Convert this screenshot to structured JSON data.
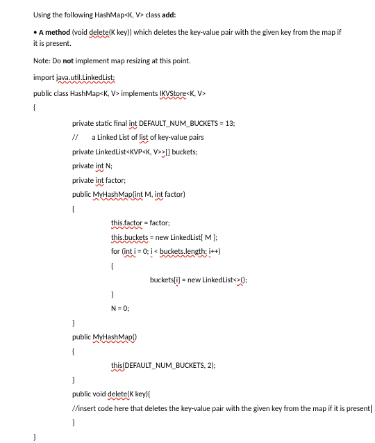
{
  "intro_prefix": "Using the following HashMap<K, V> class ",
  "intro_bold": "add:",
  "bullet_bold": "A method",
  "bullet_prefix": " (void ",
  "bullet_wavy": "delete(",
  "bullet_after": "K key)) which deletes the key-value pair with the given key from the map if it is present.",
  "note_prefix": "Note: Do ",
  "note_bold": "not",
  "note_after": " implement map resizing at this point.",
  "code": {
    "import_prefix": "import ",
    "import_wavy": "java.util.LinkedList;",
    "class_prefix": "public class HashMap<K, V> implements ",
    "class_wavy": "IKVStore",
    "class_suffix": "<K, V>",
    "open_brace": "{",
    "field1_prefix": "private static final ",
    "field1_wavy": "int",
    "field1_after": " DEFAULT_NUM_BUCKETS = 13;",
    "field2_prefix": "//        a Linked List of ",
    "field2_wavy": "list",
    "field2_after": " of key-value pairs",
    "field3_prefix": "private LinkedList<KVP<K, V>",
    "field3_wavy": ">[]",
    "field3_after": " buckets;",
    "field4_prefix": "private ",
    "field4_wavy": "int",
    "field4_after": " N;",
    "field5_prefix": "private ",
    "field5_wavy": "int",
    "field5_after": " factor;",
    "ctor1_prefix": "public ",
    "ctor1_wavy1": "MyHashMap(int",
    "ctor1_mid": " M, ",
    "ctor1_wavy2": "int",
    "ctor1_after": " factor)",
    "body_open": "{",
    "stmt1_wavy": "this.factor",
    "stmt1_after": " = factor;",
    "stmt2_wavy": "this.buckets",
    "stmt2_after": " = new LinkedList[ M ];",
    "stmt3_prefix": "for (",
    "stmt3_wavy1": "int i",
    "stmt3_mid1": " = 0; ",
    "stmt3_wavy2": "i",
    "stmt3_mid2": " < ",
    "stmt3_wavy3": "buckets.length;",
    "stmt3_mid3": " ",
    "stmt3_wavy4": "i",
    "stmt3_after": "++)",
    "for_open": "{",
    "stmt4_prefix": "buckets[",
    "stmt4_wavy1": "i",
    "stmt4_mid": "] = new LinkedList<",
    "stmt4_wavy2": ">(",
    "stmt4_after": ");",
    "for_close": "}",
    "stmt5": "N = 0;",
    "body_close": "}",
    "ctor2_prefix": "public ",
    "ctor2_wavy": "MyHashMap(",
    "ctor2_after": ")",
    "ctor2_open": "{",
    "ctor2_stmt_wavy": "this(",
    "ctor2_stmt_after": "DEFAULT_NUM_BUCKETS, 2);",
    "ctor2_close": "}",
    "method_prefix": "public void ",
    "method_wavy": "delete(",
    "method_after": "K key){",
    "comment": "//insert code here that deletes the key-value pair with the given key from the map if it is present",
    "method_close": "}",
    "close_brace": "}"
  }
}
